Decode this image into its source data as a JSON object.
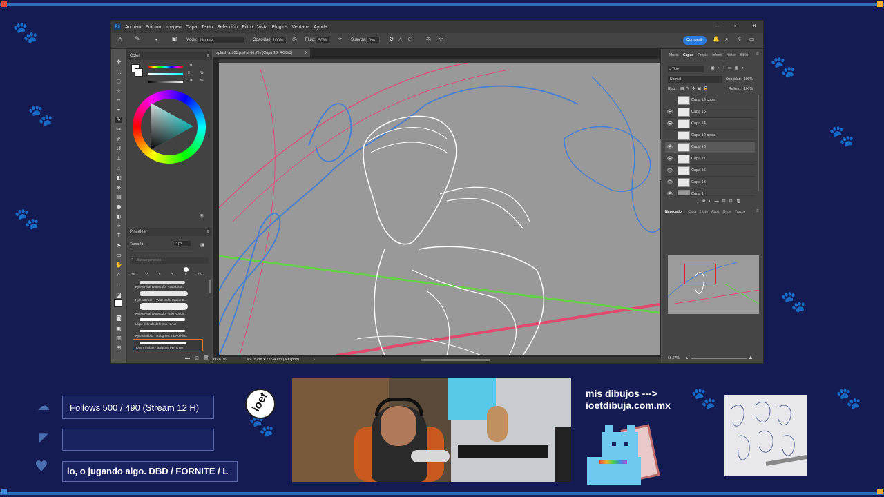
{
  "colors": {
    "accent": "#2d7be0",
    "stream_bg": "#141a52",
    "frame": "#2a6fb5"
  },
  "ps": {
    "menu": [
      "Archivo",
      "Edición",
      "Imagen",
      "Capa",
      "Texto",
      "Selección",
      "Filtro",
      "Vista",
      "Plugins",
      "Ventana",
      "Ayuda"
    ],
    "options": {
      "modo_label": "Modo:",
      "modo_value": "Normal",
      "opacidad_label": "Opacidad:",
      "opacidad_value": "100%",
      "flujo_label": "Flujo:",
      "flujo_value": "50%",
      "suavizar_label": "Suavizar:",
      "suavizar_value": "0%",
      "angle_value": "0°",
      "share_label": "Compartir"
    },
    "color_panel": {
      "title": "Color",
      "slider_values": [
        "180",
        "0",
        "100"
      ],
      "slider_units": [
        "",
        "%",
        "%"
      ]
    },
    "brushes": {
      "title": "Pinceles",
      "size_label": "Tamaño:",
      "size_value": "3 px",
      "search_placeholder": "Buscar pinceles",
      "preset_sizes": [
        "15",
        "10",
        "5",
        "3",
        "5",
        "124"
      ],
      "items": [
        {
          "label": "Kyle's Real Watercolor - 500 Ultra..."
        },
        {
          "label": "Kyle's Eraser - Watercolor Eraser E..."
        },
        {
          "label": "Kyle's Real Watercolor - Big Rough..."
        },
        {
          "label": "Lápiz definido definitivo KYLE"
        },
        {
          "label": "Kyle's Inkbox - Roughest Ink No Alias"
        },
        {
          "label": "Kyle's Inkbox - Ballpoint Pen KTW"
        }
      ]
    },
    "doc": {
      "tab_title": "splash art 01.psd al 66,7% (Capa 18, RGB/8)",
      "zoom": "66,67%",
      "dimensions": "45,18 cm x 27,94 cm (300 ppp)"
    },
    "right": {
      "tabs": [
        "Muest",
        "Capas",
        "Propie",
        "Inform",
        "Histor",
        "Bibliot"
      ],
      "filter_value": "Tipo",
      "blend_value": "Normal",
      "opacity_label": "Opacidad:",
      "opacity_value": "100%",
      "lock_label": "Bloq.:",
      "fill_label": "Relleno:",
      "fill_value": "100%",
      "layers": [
        "Capa 19 copia",
        "Capa 15",
        "Capa 14",
        "Capa 12 copia",
        "Capa 18",
        "Capa 17",
        "Capa 16",
        "Capa 13",
        "Capa 1"
      ],
      "nav_tabs": [
        "Navegador",
        "Cana",
        "Histo",
        "Ajust",
        "Orige",
        "Trazos"
      ],
      "nav_zoom": "66,67%"
    }
  },
  "overlay": {
    "follows": "Follows 500 / 490 (Stream 12 H)",
    "ticker": "lo, o jugando algo. DBD / FORNITE / L",
    "site_text_1": "mis dibujos --->",
    "site_text_2": "ioetdibuja.com.mx",
    "logo_text": "ioet"
  }
}
